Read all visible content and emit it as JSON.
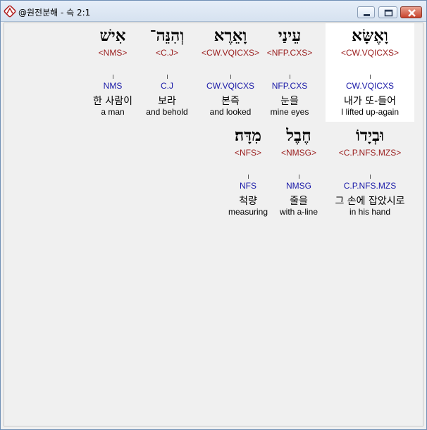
{
  "window": {
    "title": "@원전분해 - 슥 2:1",
    "icon": "app-icon",
    "controls": [
      "minimize-icon",
      "maximize-icon",
      "close-icon"
    ]
  },
  "rows": [
    {
      "words": [
        {
          "hebrew": "וָאֶשָּׂא",
          "parse": "<CW.VQICXS>",
          "code": "CW.VQICXS",
          "korean": "내가 또-들어",
          "english": "I lifted up-again",
          "selected": true
        },
        {
          "hebrew": "עֵינַי",
          "parse": "<NFP.CXS>",
          "code": "NFP.CXS",
          "korean": "눈을",
          "english": "mine eyes"
        },
        {
          "hebrew": "וָאֵרֶא",
          "parse": "<CW.VQICXS>",
          "code": "CW.VQICXS",
          "korean": "본즉",
          "english": "and looked"
        },
        {
          "hebrew": "וְהִנֵּה־",
          "parse": "<C.J>",
          "code": "C.J",
          "korean": "보라",
          "english": "and behold"
        },
        {
          "hebrew": "אִישׁ",
          "parse": "<NMS>",
          "code": "NMS",
          "korean": "한 사람이",
          "english": "a man"
        }
      ]
    },
    {
      "words": [
        {
          "hebrew": "וּבְיָדוֹ",
          "parse": "<C.P.NFS.MZS>",
          "code": "C.P.NFS.MZS",
          "korean": "그 손에 잡았시로",
          "english": "in his hand"
        },
        {
          "hebrew": "חֶבֶל",
          "parse": "<NMSG>",
          "code": "NMSG",
          "korean": "줄을",
          "english": "with a-line"
        },
        {
          "hebrew": "מִדָּה׃",
          "parse": "<NFS>",
          "code": "NFS",
          "korean": "척량",
          "english": "measuring"
        }
      ]
    }
  ]
}
